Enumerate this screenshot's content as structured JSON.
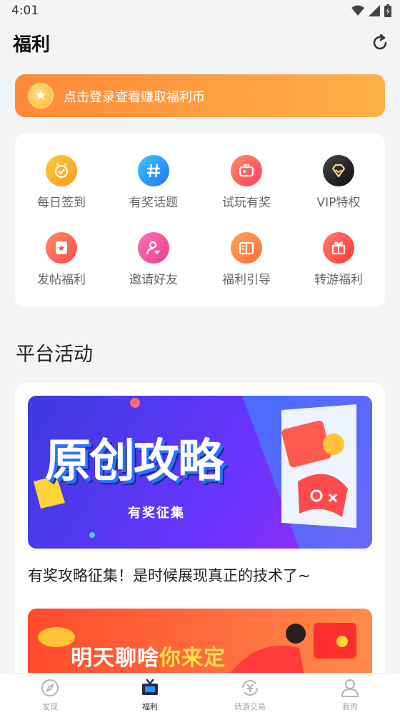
{
  "status_bar": {
    "time": "4:01"
  },
  "header": {
    "title": "福利"
  },
  "login_banner": {
    "text": "点击登录查看赚取福利币"
  },
  "grid": [
    {
      "label": "每日签到",
      "icon": "clock-check-icon",
      "color": "#f7b12b"
    },
    {
      "label": "有奖话题",
      "icon": "hashtag-icon",
      "color": "#1f8ff5"
    },
    {
      "label": "试玩有奖",
      "icon": "gamepad-icon",
      "color": "#ff5a5f"
    },
    {
      "label": "VIP特权",
      "icon": "diamond-icon",
      "color": "#222222"
    },
    {
      "label": "发帖福利",
      "icon": "post-star-icon",
      "color": "#ff5f5a"
    },
    {
      "label": "邀请好友",
      "icon": "invite-user-icon",
      "color": "#f54ea2"
    },
    {
      "label": "福利引导",
      "icon": "book-icon",
      "color": "#ff7d4a"
    },
    {
      "label": "转游福利",
      "icon": "gift-icon",
      "color": "#ff4f4f"
    }
  ],
  "section": {
    "title": "平台活动"
  },
  "activities": [
    {
      "banner_text": "原创攻略",
      "banner_sub": "有奖征集",
      "caption": "有奖攻略征集！是时候展现真正的技术了~"
    },
    {
      "banner_text_a": "明天聊啥",
      "banner_text_b": "你来定"
    }
  ],
  "tabbar": [
    {
      "label": "发现",
      "icon": "compass-icon",
      "active": false
    },
    {
      "label": "福利",
      "icon": "gift-box-icon",
      "active": true
    },
    {
      "label": "转游交易",
      "icon": "exchange-yen-icon",
      "active": false
    },
    {
      "label": "我的",
      "icon": "user-icon",
      "active": false
    }
  ]
}
